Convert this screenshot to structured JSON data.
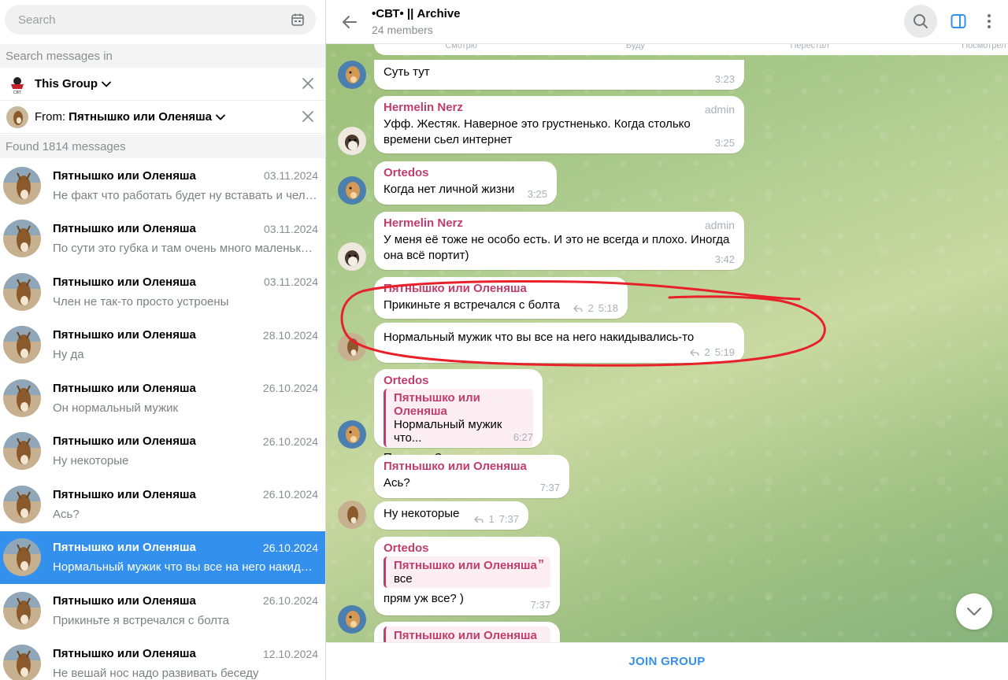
{
  "left": {
    "search_placeholder": "Search",
    "search_in_label": "Search messages in",
    "scope": "This Group",
    "from_prefix": "From:",
    "from_name": "Пятнышко или Оленяша",
    "found_label": "Found 1814 messages",
    "results": [
      {
        "name": "Пятнышко или Оленяша",
        "date": "03.11.2024",
        "text": "Не факт что работать будет ну вставать и человек"
      },
      {
        "name": "Пятнышко или Оленяша",
        "date": "03.11.2024",
        "text": "По сути это губка и там очень много маленьких сосудов"
      },
      {
        "name": "Пятнышко или Оленяша",
        "date": "03.11.2024",
        "text": "Член не так-то просто устроены"
      },
      {
        "name": "Пятнышко или Оленяша",
        "date": "28.10.2024",
        "text": "Ну да"
      },
      {
        "name": "Пятнышко или Оленяша",
        "date": "26.10.2024",
        "text": "Он нормальный мужик"
      },
      {
        "name": "Пятнышко или Оленяша",
        "date": "26.10.2024",
        "text": "Ну некоторые"
      },
      {
        "name": "Пятнышко или Оленяша",
        "date": "26.10.2024",
        "text": "Ась?"
      },
      {
        "name": "Пятнышко или Оленяша",
        "date": "26.10.2024",
        "text": "Нормальный мужик что вы все на него накидывались-то",
        "active": true
      },
      {
        "name": "Пятнышко или Оленяша",
        "date": "26.10.2024",
        "text": "Прикиньте я встречался с болта"
      },
      {
        "name": "Пятнышко или Оленяша",
        "date": "12.10.2024",
        "text": "Не вешай нос надо развивать беседу"
      }
    ]
  },
  "header": {
    "title": "•СВТ• || Archive",
    "subtitle": "24 members"
  },
  "chat": {
    "top_tabs": [
      "Смотрю",
      "Буду",
      "Перестал",
      "Посмотрел"
    ],
    "messages": {
      "m1": {
        "text": "Суть тут",
        "time": "3:23"
      },
      "m2": {
        "sender": "Hermelin Nerz",
        "badge": "admin",
        "text": "Уфф. Жестяк. Наверное это грустненько. Когда столько времени сьел интернет",
        "time": "3:25"
      },
      "m3": {
        "sender": "Ortedos",
        "text": "Когда нет личной жизни",
        "time": "3:25"
      },
      "m4": {
        "sender": "Hermelin Nerz",
        "badge": "admin",
        "text": "У меня её тоже не особо есть. И это не всегда и плохо. Иногда она всё портит)",
        "time": "3:42"
      },
      "m5": {
        "sender": "Пятнышко или Оленяша",
        "text": "Прикиньте я встречался с болта",
        "replies": "2",
        "time": "5:18"
      },
      "m6": {
        "text": "Нормальный мужик что вы все на него накидывались-то",
        "replies": "2",
        "time": "5:19"
      },
      "m7": {
        "sender": "Ortedos",
        "quote_name": "Пятнышко или Оленяша",
        "quote_text": "Нормальный мужик что...",
        "text": "Прям все?",
        "time": "6:27"
      },
      "m8": {
        "sender": "Пятнышко или Оленяша",
        "text": "Ась?",
        "time": "7:37"
      },
      "m9": {
        "text": "Ну некоторые",
        "replies": "1",
        "time": "7:37"
      },
      "m10": {
        "sender": "Ortedos",
        "quote_name": "Пятнышко или Оленяша",
        "quote_text": "все",
        "text": "прям уж все? )",
        "time": "7:37"
      },
      "m11": {
        "quote_name": "Пятнышко или Оленяша"
      }
    }
  },
  "join_label": "JOIN GROUP",
  "colors": {
    "accent": "#3390ec",
    "sender_pink": "#c03d6c",
    "annotation_red": "#e8202a"
  }
}
